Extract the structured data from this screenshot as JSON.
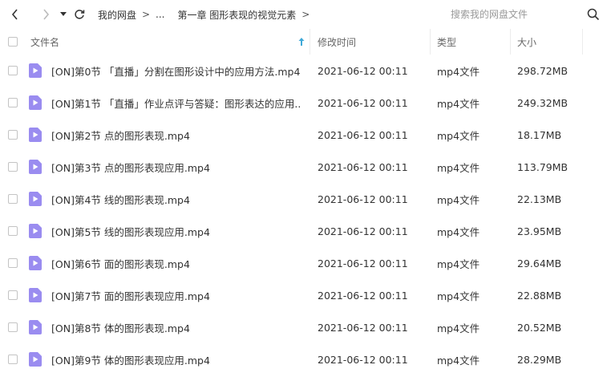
{
  "toolbar": {
    "breadcrumbs": [
      "我的网盘",
      "...",
      "第一章 图形表现的视觉元素"
    ],
    "separator": ">",
    "search_placeholder": "搜索我的网盘文件"
  },
  "icons": {
    "back": "chevron-left-icon",
    "forward": "chevron-right-icon",
    "history": "caret-down-icon",
    "refresh": "refresh-icon",
    "search": "search-icon",
    "file": "video-file-icon",
    "sort": "sort-arrow-up-icon"
  },
  "colors": {
    "file_icon": "#9a8cf0",
    "header_text": "#666666",
    "text": "#333333"
  },
  "columns": {
    "name": "文件名",
    "date": "修改时间",
    "type": "类型",
    "size": "大小"
  },
  "files": [
    {
      "name": "[ON]第0节 「直播」分割在图形设计中的应用方法.mp4",
      "date": "2021-06-12 00:11",
      "type": "mp4文件",
      "size": "298.72MB"
    },
    {
      "name": "[ON]第1节 「直播」作业点评与答疑：图形表达的应用....",
      "date": "2021-06-12 00:11",
      "type": "mp4文件",
      "size": "249.32MB"
    },
    {
      "name": "[ON]第2节 点的图形表现.mp4",
      "date": "2021-06-12 00:11",
      "type": "mp4文件",
      "size": "18.17MB"
    },
    {
      "name": "[ON]第3节 点的图形表现应用.mp4",
      "date": "2021-06-12 00:11",
      "type": "mp4文件",
      "size": "113.79MB"
    },
    {
      "name": "[ON]第4节 线的图形表现.mp4",
      "date": "2021-06-12 00:11",
      "type": "mp4文件",
      "size": "22.13MB"
    },
    {
      "name": "[ON]第5节 线的图形表现应用.mp4",
      "date": "2021-06-12 00:11",
      "type": "mp4文件",
      "size": "23.95MB"
    },
    {
      "name": "[ON]第6节 面的图形表现.mp4",
      "date": "2021-06-12 00:11",
      "type": "mp4文件",
      "size": "29.64MB"
    },
    {
      "name": "[ON]第7节 面的图形表现应用.mp4",
      "date": "2021-06-12 00:11",
      "type": "mp4文件",
      "size": "22.88MB"
    },
    {
      "name": "[ON]第8节 体的图形表现.mp4",
      "date": "2021-06-12 00:11",
      "type": "mp4文件",
      "size": "20.52MB"
    },
    {
      "name": "[ON]第9节 体的图形表现应用.mp4",
      "date": "2021-06-12 00:11",
      "type": "mp4文件",
      "size": "28.29MB"
    }
  ]
}
